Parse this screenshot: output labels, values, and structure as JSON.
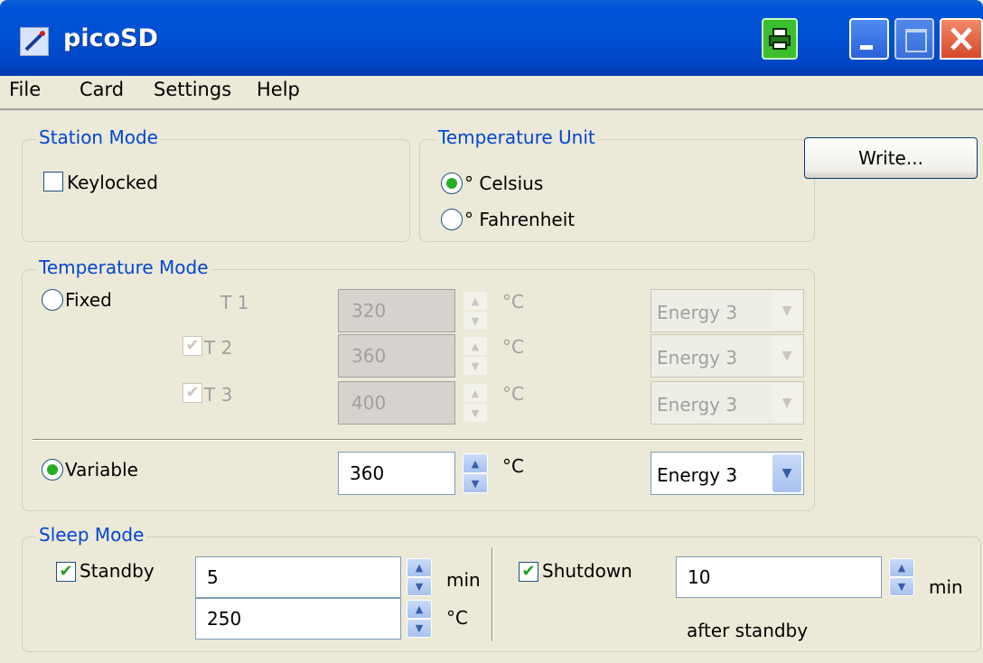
{
  "window": {
    "title": "picoSD"
  },
  "menu": [
    "File",
    "Card",
    "Settings",
    "Help"
  ],
  "station_mode": {
    "label": "Station Mode",
    "keylocked": {
      "label": "Keylocked",
      "checked": false
    }
  },
  "temperature_unit": {
    "label": "Temperature Unit",
    "celsius": "° Celsius",
    "fahrenheit": "° Fahrenheit",
    "selected": "celsius"
  },
  "write_button": "Write...",
  "temperature_mode": {
    "label": "Temperature Mode",
    "fixed": {
      "label": "Fixed",
      "selected": false
    },
    "rows": [
      {
        "label": "T 1",
        "value": "320",
        "unit": "°C",
        "energy": "Energy 3",
        "checkbox": false
      },
      {
        "label": "T 2",
        "value": "360",
        "unit": "°C",
        "energy": "Energy 3",
        "checkbox": true,
        "checked": true
      },
      {
        "label": "T 3",
        "value": "400",
        "unit": "°C",
        "energy": "Energy 3",
        "checkbox": true,
        "checked": true
      }
    ],
    "variable": {
      "label": "Variable",
      "selected": true,
      "value": "360",
      "unit": "°C",
      "energy": "Energy 3"
    }
  },
  "sleep_mode": {
    "label": "Sleep Mode",
    "standby": {
      "label": "Standby",
      "checked": true,
      "minutes": "5",
      "min_unit": "min",
      "temp": "250",
      "temp_unit": "°C"
    },
    "shutdown": {
      "label": "Shutdown",
      "checked": true,
      "minutes": "10",
      "min_unit": "min",
      "note": "after standby"
    }
  },
  "colors": {
    "title_bar": "#0053d6",
    "group_label": "#0046d5",
    "background": "#ece9d8",
    "check": "#21a121"
  }
}
